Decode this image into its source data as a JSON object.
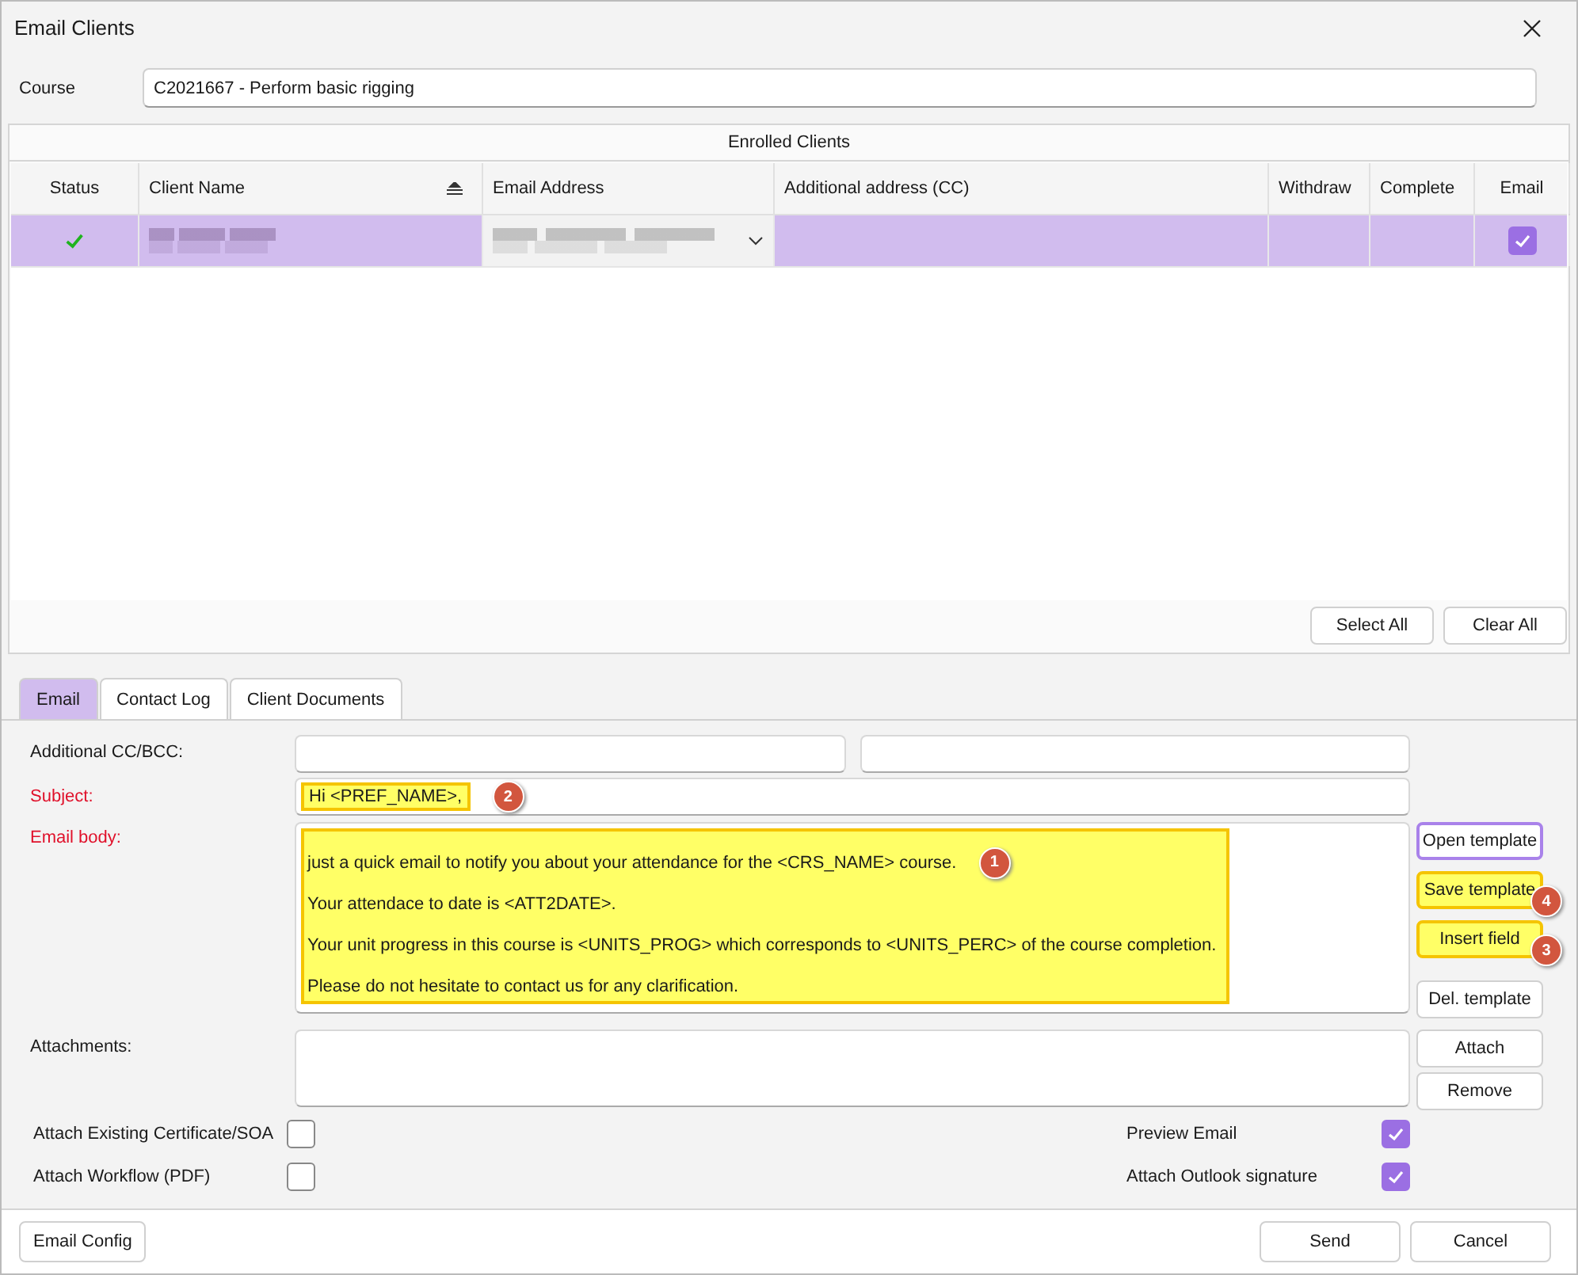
{
  "window": {
    "title": "Email Clients"
  },
  "course": {
    "label": "Course",
    "value": "C2021667 - Perform basic rigging"
  },
  "enrolled": {
    "title": "Enrolled Clients",
    "columns": [
      {
        "label": "Status",
        "sorted": false
      },
      {
        "label": "Client Name",
        "sorted": true
      },
      {
        "label": "Email Address",
        "sorted": false
      },
      {
        "label": "Additional address (CC)",
        "sorted": false
      },
      {
        "label": "Withdraw",
        "sorted": false
      },
      {
        "label": "Complete",
        "sorted": false
      },
      {
        "label": "Email",
        "sorted": false
      }
    ],
    "rows": [
      {
        "status_ok": true,
        "selected": true,
        "email_checked": true
      }
    ],
    "buttons": [
      "Select All",
      "Clear All"
    ]
  },
  "tabs": [
    {
      "label": "Email",
      "selected": true
    },
    {
      "label": "Contact Log",
      "selected": false
    },
    {
      "label": "Client Documents",
      "selected": false
    }
  ],
  "form": {
    "cc": {
      "label": "Additional CC/BCC:"
    },
    "subject": {
      "label": "Subject:",
      "required": true,
      "value": "Hi <PREF_NAME>,",
      "highlighted": true,
      "badge": "2"
    },
    "body": {
      "label": "Email body:",
      "required": true,
      "highlighted": true,
      "lines": [
        {
          "text": "just a quick email to notify you about your attendance for the <CRS_NAME> course.",
          "badge": "1"
        },
        {
          "text": "Your attendace to date is <ATT2DATE>."
        },
        {
          "text": "Your unit progress in this course is <UNITS_PROG> which corresponds to <UNITS_PERC> of the course completion."
        },
        {
          "text": "Please do not hesitate to contact us for any clarification."
        }
      ]
    },
    "template_buttons": [
      {
        "label": "Open template",
        "focused": true,
        "highlighted": false
      },
      {
        "label": "Save template",
        "focused": false,
        "highlighted": true,
        "badge": "4"
      },
      {
        "label": "Insert field",
        "focused": false,
        "highlighted": true,
        "badge": "3"
      },
      {
        "label": "Del. template",
        "focused": false,
        "highlighted": false
      }
    ],
    "attachments": {
      "label": "Attachments:",
      "buttons": [
        "Attach",
        "Remove"
      ]
    },
    "options_left": [
      {
        "label": "Attach Existing Certificate/SOA",
        "checked": false
      },
      {
        "label": "Attach Workflow (PDF)",
        "checked": false
      }
    ],
    "options_right": [
      {
        "label": "Preview Email",
        "checked": true
      },
      {
        "label": "Attach Outlook signature",
        "checked": true
      }
    ]
  },
  "footer": {
    "left": "Email Config",
    "right": [
      "Send",
      "Cancel"
    ]
  }
}
